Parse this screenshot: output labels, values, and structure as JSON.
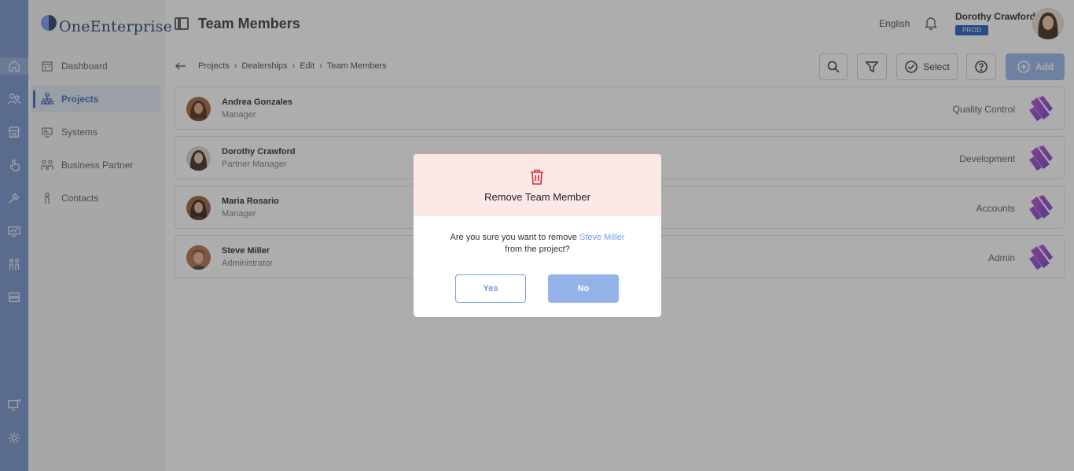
{
  "app": {
    "logo_text": "OneEnterprise"
  },
  "nav": {
    "items": [
      {
        "label": "Dashboard",
        "icon": "calendar-icon",
        "active": false
      },
      {
        "label": "Projects",
        "icon": "hierarchy-icon",
        "active": true
      },
      {
        "label": "Systems",
        "icon": "systems-icon",
        "active": false
      },
      {
        "label": "Business Partner",
        "icon": "partners-icon",
        "active": false
      },
      {
        "label": "Contacts",
        "icon": "contact-icon",
        "active": false
      }
    ]
  },
  "rail": {
    "icons": [
      "home-icon",
      "people-icon",
      "store-icon",
      "hand-icon",
      "tools-icon",
      "monitor-chart-icon",
      "team-icon",
      "server-icon",
      "remote-desktop-icon",
      "settings-icon"
    ]
  },
  "header": {
    "title": "Team Members",
    "language": "English",
    "user_name": "Dorothy Crawford",
    "env_badge": "PROD"
  },
  "breadcrumb": [
    "Projects",
    "Dealerships",
    "Edit",
    "Team Members"
  ],
  "toolbar": {
    "select_label": "Select",
    "add_label": "Add"
  },
  "members": [
    {
      "name": "Andrea Gonzales",
      "role": "Manager",
      "department": "Quality Control"
    },
    {
      "name": "Dorothy Crawford",
      "role": "Partner Manager",
      "department": "Development"
    },
    {
      "name": "Maria Rosario",
      "role": "Manager",
      "department": "Accounts"
    },
    {
      "name": "Steve Miller",
      "role": "Administrator",
      "department": "Admin"
    }
  ],
  "modal": {
    "title": "Remove Team Member",
    "message_prefix": "Are you sure you want to remove",
    "member_name": "Steve Miller",
    "message_suffix": "from the project?",
    "yes_label": "Yes",
    "no_label": "No"
  },
  "colors": {
    "rail": "#6f8fc9",
    "accent": "#3d64b4",
    "primary_button": "#93b3e8",
    "danger": "#d9302b",
    "modal_header": "#fde8e8",
    "env_badge": "#1a56b8"
  }
}
